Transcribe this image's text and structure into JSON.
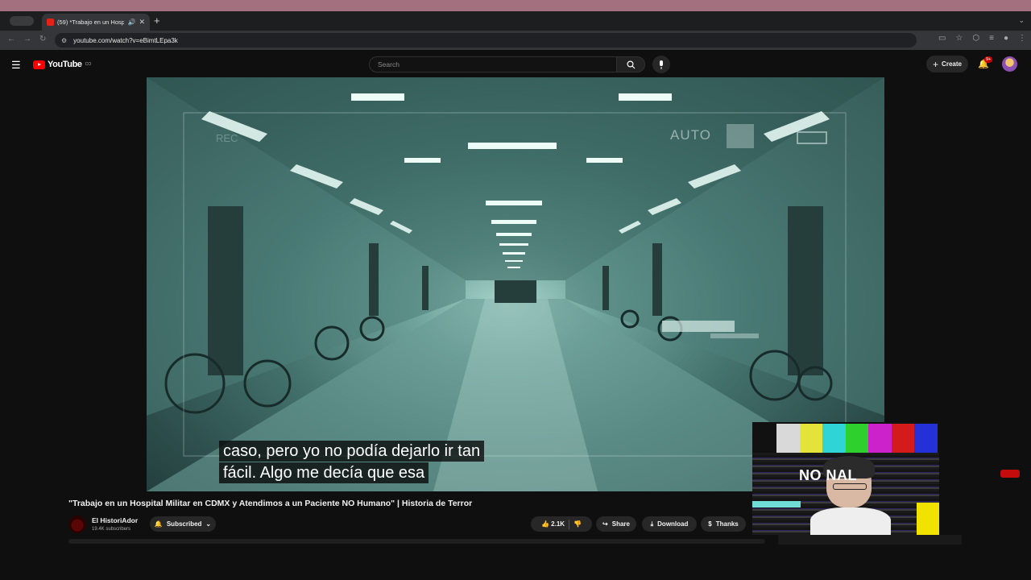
{
  "browser": {
    "tab_title": "(59) *Trabajo en un Hosp",
    "url": "youtube.com/watch?v=eBimtLEpa3k"
  },
  "youtube": {
    "logo_text": "YouTube",
    "logo_sup": "CO",
    "search_placeholder": "Search",
    "create_label": "Create",
    "notifications_badge": "9+"
  },
  "player": {
    "osd_mode": "AUTO",
    "osd_rec": "REC",
    "captions": [
      "caso, pero yo no podía dejarlo ir tan",
      "fácil. Algo me decía que esa"
    ]
  },
  "video": {
    "title": "\"Trabajo en un Hospital Militar en CDMX y Atendimos a un Paciente NO Humano\" | Historia de Terror",
    "channel_name": "El HistoriAdor",
    "subscribers": "19.4K subscribers",
    "subscribe_state": "Subscribed",
    "likes": "2.1K",
    "share_label": "Share",
    "download_label": "Download",
    "thanks_label": "Thanks"
  },
  "webcam_overlay": {
    "text": "NO NAL",
    "colors": [
      "#d9d9d9",
      "#e3e33a",
      "#2fd4d6",
      "#2dd02d",
      "#cc22cc",
      "#d41b1b",
      "#2430d8"
    ]
  }
}
